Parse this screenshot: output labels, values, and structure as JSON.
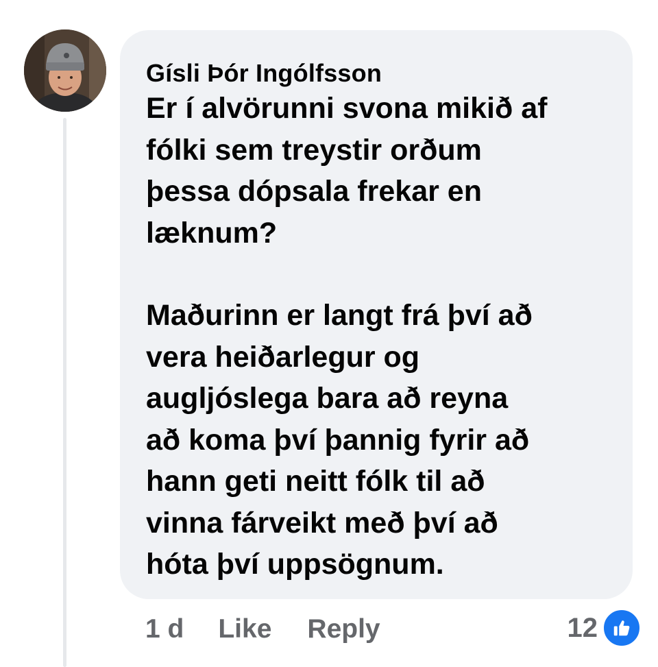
{
  "comment": {
    "author": "Gísli Þór Ingólfsson",
    "paragraph_1": [
      "Er í alvörunni svona mikið af",
      "fólki sem treystir orðum",
      "þessa dópsala frekar en",
      "læknum?"
    ],
    "paragraph_2": [
      "Maðurinn er langt frá því að",
      "vera heiðarlegur og",
      "augljóslega bara að reyna",
      "að koma því þannig fyrir að",
      "hann geti neitt fólk til að",
      "vinna fárveikt með því að",
      "hóta því uppsögnum."
    ]
  },
  "actions": {
    "timestamp": "1 d",
    "like_label": "Like",
    "reply_label": "Reply"
  },
  "reactions": {
    "count": "12",
    "icon": "thumbs-up-icon"
  },
  "colors": {
    "bubble_bg": "#f0f2f5",
    "text": "#050505",
    "secondary_text": "#65676b",
    "like_blue": "#1877f2",
    "thread_line": "#e6e8eb"
  }
}
